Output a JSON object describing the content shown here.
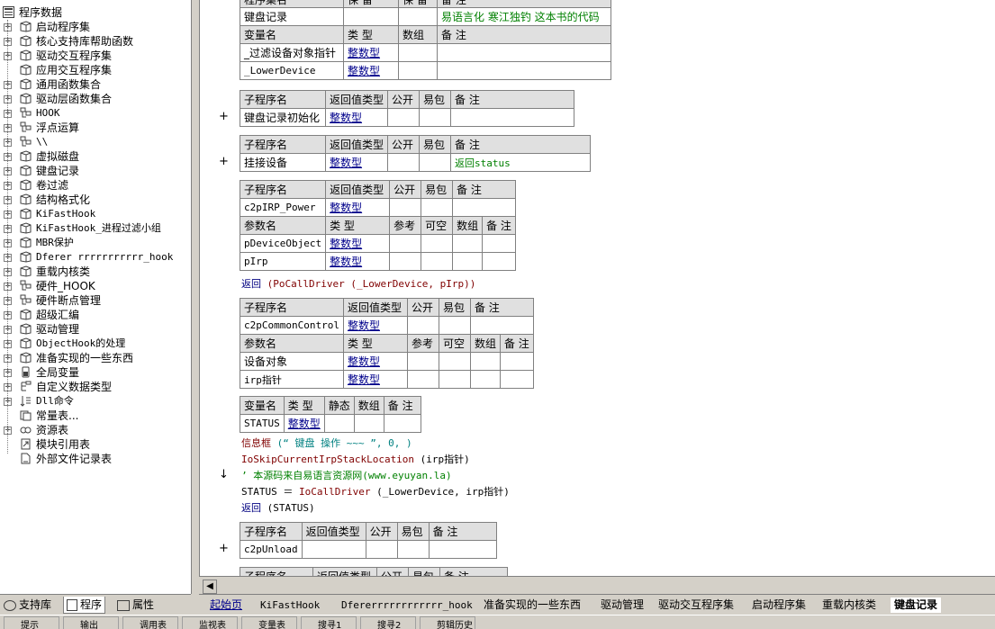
{
  "tree": {
    "root": "程序数据",
    "items": [
      {
        "label": "启动程序集",
        "icon": "module-icon",
        "expandable": true
      },
      {
        "label": "核心支持库帮助函数",
        "icon": "module-icon",
        "expandable": true
      },
      {
        "label": "驱动交互程序集",
        "icon": "module-icon",
        "expandable": true
      },
      {
        "label": "应用交互程序集",
        "icon": "module-icon",
        "expandable": false
      },
      {
        "label": "通用函数集合",
        "icon": "module-icon",
        "expandable": true
      },
      {
        "label": "驱动层函数集合",
        "icon": "module-icon",
        "expandable": true
      },
      {
        "label": "HOOK",
        "icon": "class-icon",
        "expandable": true
      },
      {
        "label": "浮点运算",
        "icon": "class-icon",
        "expandable": true
      },
      {
        "label": "\\\\",
        "icon": "class-icon",
        "expandable": true
      },
      {
        "label": "虚拟磁盘",
        "icon": "module-icon",
        "expandable": true
      },
      {
        "label": "键盘记录",
        "icon": "module-icon",
        "expandable": true
      },
      {
        "label": "卷过滤",
        "icon": "module-icon",
        "expandable": true
      },
      {
        "label": "结构格式化",
        "icon": "module-icon",
        "expandable": true
      },
      {
        "label": "KiFastHook",
        "icon": "module-icon",
        "expandable": true
      },
      {
        "label": "KiFastHook_进程过滤小组",
        "icon": "module-icon",
        "expandable": true
      },
      {
        "label": "MBR保护",
        "icon": "module-icon",
        "expandable": true
      },
      {
        "label": "Dferer rrrrrrrrrrr_hook",
        "icon": "module-icon",
        "expandable": true
      },
      {
        "label": "重载内核类",
        "icon": "module-icon",
        "expandable": true
      },
      {
        "label": "硬件_HOOK",
        "icon": "class-icon",
        "expandable": true
      },
      {
        "label": "硬件断点管理",
        "icon": "class-icon",
        "expandable": true
      },
      {
        "label": "超级汇编",
        "icon": "module-icon",
        "expandable": true
      },
      {
        "label": "驱动管理",
        "icon": "module-icon",
        "expandable": true
      },
      {
        "label": "ObjectHook的处理",
        "icon": "module-icon",
        "expandable": true
      },
      {
        "label": "准备实现的一些东西",
        "icon": "module-icon",
        "expandable": true
      },
      {
        "label": "全局变量",
        "icon": "globals-icon",
        "expandable": true
      },
      {
        "label": "自定义数据类型",
        "icon": "datatype-icon",
        "expandable": true
      },
      {
        "label": "Dll命令",
        "icon": "dll-icon",
        "expandable": true
      },
      {
        "label": "常量表...",
        "icon": "constants-icon",
        "expandable": false
      },
      {
        "label": "资源表",
        "icon": "resource-icon",
        "expandable": true
      },
      {
        "label": "模块引用表",
        "icon": "module-ref-icon",
        "expandable": false
      },
      {
        "label": "外部文件记录表",
        "icon": "file-record-icon",
        "expandable": false
      }
    ]
  },
  "left_tabs": [
    "支持库",
    "程序",
    "属性"
  ],
  "doc_tabs": [
    "起始页",
    "KiFastHook",
    "Dfererrrrrrrrrrrr_hook",
    "准备实现的一些东西",
    "驱动管理",
    "驱动交互程序集",
    "启动程序集",
    "重载内核类",
    "键盘记录"
  ],
  "code": {
    "top_header": [
      "程序集名",
      "保 留",
      "保 留",
      "备 注"
    ],
    "assembly": {
      "name": "键盘记录",
      "note": "易语言化 寒江独钓 这本书的代码"
    },
    "var_header": [
      "变量名",
      "类 型",
      "数组",
      "备 注"
    ],
    "vars": [
      {
        "name": "_过滤设备对象指针",
        "type": "整数型"
      },
      {
        "name": "_LowerDevice",
        "type": "整数型"
      }
    ],
    "sub_header": [
      "子程序名",
      "返回值类型",
      "公开",
      "易包",
      "备 注"
    ],
    "param_header": [
      "参数名",
      "类 型",
      "参考",
      "可空",
      "数组",
      "备 注"
    ],
    "local_header": [
      "变量名",
      "类 型",
      "静态",
      "数组",
      "备 注"
    ],
    "sub1": {
      "name": "键盘记录初始化",
      "ret": "整数型"
    },
    "sub2": {
      "name": "挂接设备",
      "ret": "整数型",
      "note": "返回status"
    },
    "sub3": {
      "name": "c2pIRP_Power",
      "ret": "整数型",
      "params": [
        {
          "name": "pDeviceObject",
          "type": "整数型"
        },
        {
          "name": "pIrp",
          "type": "整数型"
        }
      ],
      "line": "(PoCallDriver (_LowerDevice, pIrp))"
    },
    "sub4": {
      "name": "c2pCommonControl",
      "ret": "整数型",
      "params": [
        {
          "name": "设备对象",
          "type": "整数型"
        },
        {
          "name": "irp指针",
          "type": "整数型"
        }
      ],
      "local": {
        "name": "STATUS",
        "type": "整数型"
      },
      "lines": [
        {
          "a": "信息框",
          "b": " (“ 键盘 操作 ~~~ ”, 0, )"
        },
        {
          "a": "IoSkipCurrentIrpStackLocation",
          "b": " (irp指针)"
        },
        {
          "a": "’ 本源码来自易语言资源网",
          "b": "(www.eyuyan.la)"
        },
        {
          "a": "STATUS ＝ ",
          "b": "IoCallDriver",
          "c": " (_LowerDevice, irp指针)"
        },
        {
          "a": "返回",
          "b": " (STATUS)"
        }
      ]
    },
    "sub5": {
      "name": "c2pUnload"
    },
    "return_kw": "返回",
    "cut_header": [
      "子程序名",
      "返回值类型",
      "公开",
      "易包",
      "备 注"
    ]
  },
  "status_bar": [
    "提示",
    "输出",
    "调用表",
    "监视表",
    "变量表",
    "搜寻1",
    "搜寻2",
    "剪辑历史"
  ]
}
